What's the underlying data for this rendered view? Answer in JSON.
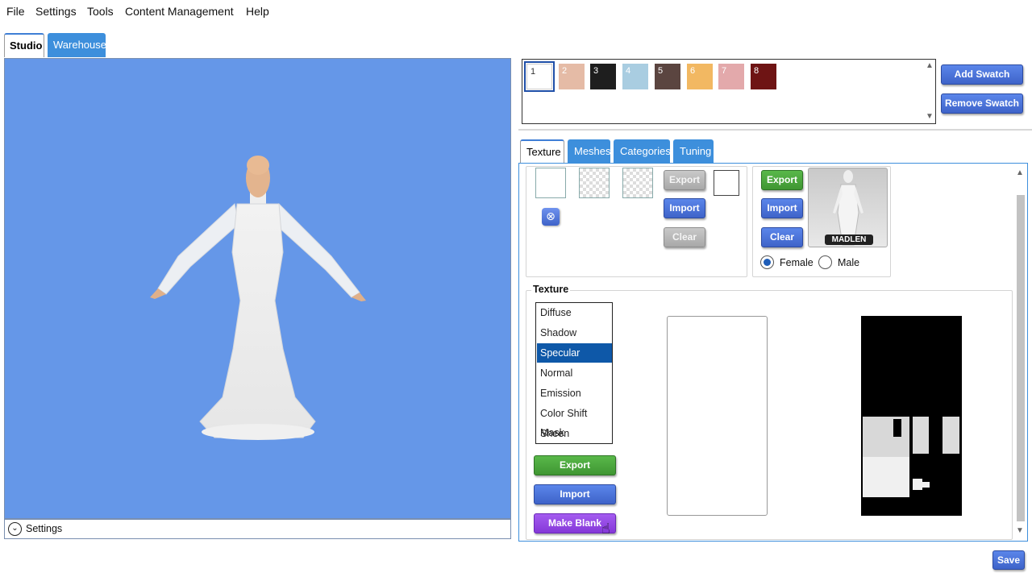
{
  "menu": [
    "File",
    "Settings",
    "Tools",
    "Content Management",
    "Help"
  ],
  "main_tabs": [
    {
      "label": "Studio",
      "active": true
    },
    {
      "label": "Warehouse",
      "active": false
    }
  ],
  "viewport": {
    "background": "#6597e8",
    "settings_label": "Settings"
  },
  "swatches": [
    {
      "label": "1",
      "color": "#ffffff",
      "selected": true
    },
    {
      "label": "2",
      "color": "#e5bba6"
    },
    {
      "label": "3",
      "color": "#1e1e1e"
    },
    {
      "label": "4",
      "color": "#a9cde1"
    },
    {
      "label": "5",
      "color": "#5b4540"
    },
    {
      "label": "6",
      "color": "#f2b862"
    },
    {
      "label": "7",
      "color": "#e3a9ab"
    },
    {
      "label": "8",
      "color": "#6e1414"
    }
  ],
  "swatch_buttons": {
    "add": "Add Swatch",
    "remove": "Remove Swatch"
  },
  "sub_tabs": [
    {
      "label": "Texture",
      "active": true
    },
    {
      "label": "Meshes"
    },
    {
      "label": "Categories"
    },
    {
      "label": "Tuning"
    }
  ],
  "thumb_buttons": {
    "export": "Export",
    "import": "Import",
    "clear": "Clear"
  },
  "model_group": {
    "export": "Export",
    "import": "Import",
    "clear": "Clear",
    "model_name": "MADLEN",
    "female": "Female",
    "male": "Male",
    "selected": "Female"
  },
  "texture_group": {
    "title": "Texture",
    "items": [
      "Diffuse",
      "Shadow",
      "Specular",
      "Normal",
      "Emission",
      "Color Shift Mask",
      "Sheen"
    ],
    "selected": "Specular",
    "export": "Export",
    "import": "Import",
    "make_blank": "Make Blank"
  },
  "save": "Save",
  "colors": {
    "accent_tab": "#3d8fdc",
    "button_blue": "#4a70d8",
    "button_green": "#4aa63d",
    "button_purple": "#9048e0",
    "selected_list": "#0e58a8"
  }
}
